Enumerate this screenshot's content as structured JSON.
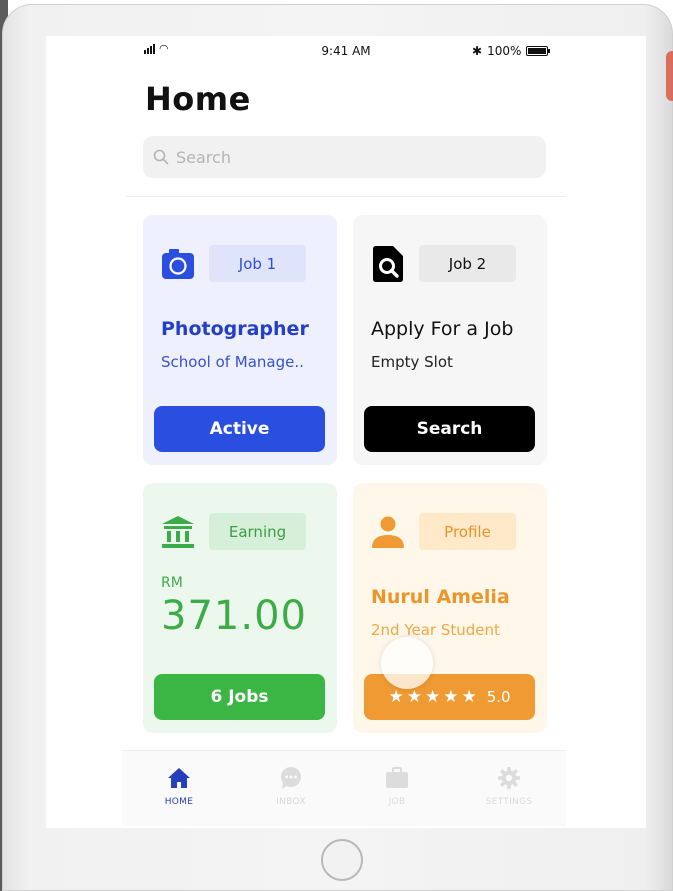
{
  "status_bar": {
    "time": "9:41 AM",
    "battery": "100%"
  },
  "page_title": "Home",
  "search": {
    "placeholder": "Search"
  },
  "cards": [
    {
      "chip": "Job 1",
      "title": "Photographer",
      "subtitle": "School of Manage..",
      "button": "Active",
      "icon": "camera-icon"
    },
    {
      "chip": "Job 2",
      "title": "Apply For a Job",
      "subtitle": "Empty Slot",
      "button": "Search",
      "icon": "document-search-icon"
    },
    {
      "chip": "Earning",
      "currency": "RM",
      "amount": "371.00",
      "button": "6 Jobs",
      "icon": "bank-icon"
    },
    {
      "chip": "Profile",
      "title": "Nurul Amelia",
      "subtitle": "2nd Year Student",
      "rating": "5.0",
      "stars": 5,
      "icon": "user-icon"
    }
  ],
  "tabs": [
    {
      "label": "HOME",
      "icon": "home-icon",
      "active": true
    },
    {
      "label": "INBOX",
      "icon": "chat-icon",
      "active": false
    },
    {
      "label": "JOB",
      "icon": "briefcase-icon",
      "active": false
    },
    {
      "label": "SETTINGS",
      "icon": "gear-icon",
      "active": false
    }
  ],
  "colors": {
    "primary": "#2a4fe0",
    "success": "#3bb644",
    "accent": "#ef9a32",
    "dark": "#000000"
  }
}
